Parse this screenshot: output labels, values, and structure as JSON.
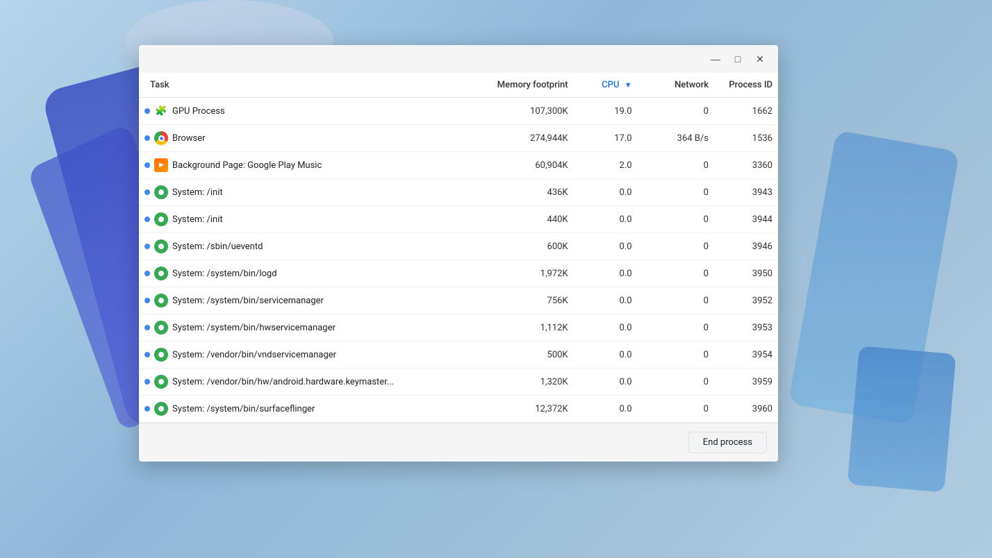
{
  "window": {
    "controls": {
      "minimize": "—",
      "maximize": "□",
      "close": "✕"
    }
  },
  "table": {
    "columns": [
      {
        "id": "task",
        "label": "Task",
        "align": "left"
      },
      {
        "id": "memory",
        "label": "Memory footprint",
        "align": "right"
      },
      {
        "id": "cpu",
        "label": "CPU",
        "align": "right",
        "sorted": true,
        "sortDir": "desc"
      },
      {
        "id": "network",
        "label": "Network",
        "align": "right"
      },
      {
        "id": "pid",
        "label": "Process ID",
        "align": "right"
      }
    ],
    "rows": [
      {
        "icon": "puzzle",
        "name": "GPU Process",
        "memory": "107,300K",
        "cpu": "19.0",
        "network": "0",
        "pid": "1662",
        "selected": false
      },
      {
        "icon": "chrome",
        "name": "Browser",
        "memory": "274,944K",
        "cpu": "17.0",
        "network": "364 B/s",
        "pid": "1536",
        "selected": false
      },
      {
        "icon": "gpm",
        "name": "Background Page: Google Play Music",
        "memory": "60,904K",
        "cpu": "2.0",
        "network": "0",
        "pid": "3360",
        "selected": false
      },
      {
        "icon": "system",
        "name": "System: /init",
        "memory": "436K",
        "cpu": "0.0",
        "network": "0",
        "pid": "3943",
        "selected": false
      },
      {
        "icon": "system",
        "name": "System: /init",
        "memory": "440K",
        "cpu": "0.0",
        "network": "0",
        "pid": "3944",
        "selected": false
      },
      {
        "icon": "system",
        "name": "System: /sbin/ueventd",
        "memory": "600K",
        "cpu": "0.0",
        "network": "0",
        "pid": "3946",
        "selected": false
      },
      {
        "icon": "system",
        "name": "System: /system/bin/logd",
        "memory": "1,972K",
        "cpu": "0.0",
        "network": "0",
        "pid": "3950",
        "selected": false
      },
      {
        "icon": "system",
        "name": "System: /system/bin/servicemanager",
        "memory": "756K",
        "cpu": "0.0",
        "network": "0",
        "pid": "3952",
        "selected": false
      },
      {
        "icon": "system",
        "name": "System: /system/bin/hwservicemanager",
        "memory": "1,112K",
        "cpu": "0.0",
        "network": "0",
        "pid": "3953",
        "selected": false
      },
      {
        "icon": "system",
        "name": "System: /vendor/bin/vndservicemanager",
        "memory": "500K",
        "cpu": "0.0",
        "network": "0",
        "pid": "3954",
        "selected": false
      },
      {
        "icon": "system",
        "name": "System: /vendor/bin/hw/android.hardware.keymaster...",
        "memory": "1,320K",
        "cpu": "0.0",
        "network": "0",
        "pid": "3959",
        "selected": false
      },
      {
        "icon": "system",
        "name": "System: /system/bin/surfaceflinger",
        "memory": "12,372K",
        "cpu": "0.0",
        "network": "0",
        "pid": "3960",
        "selected": false
      }
    ]
  },
  "footer": {
    "end_process_label": "End process"
  }
}
